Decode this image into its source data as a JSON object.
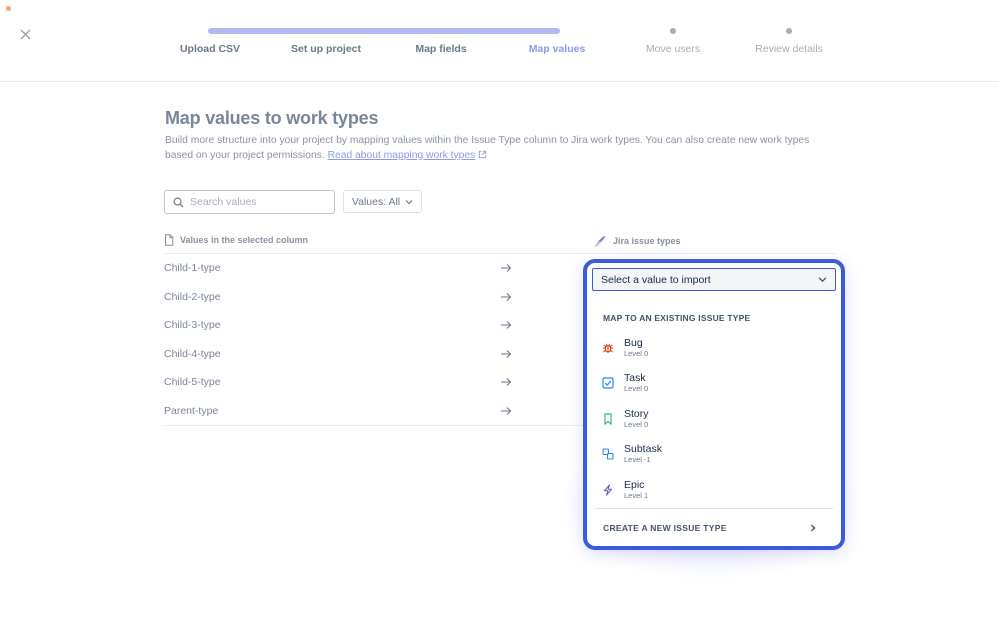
{
  "steps": [
    {
      "label": "Upload CSV",
      "state": "done"
    },
    {
      "label": "Set up project",
      "state": "done"
    },
    {
      "label": "Map fields",
      "state": "done"
    },
    {
      "label": "Map values",
      "state": "current"
    },
    {
      "label": "Move users",
      "state": "future"
    },
    {
      "label": "Review details",
      "state": "future"
    }
  ],
  "page": {
    "title": "Map values to work types",
    "description": "Build more structure into your project by mapping values within the Issue Type column to Jira work types. You can also create new work types based on your project permissions.",
    "link_text": "Read about mapping work types"
  },
  "search": {
    "placeholder": "Search values"
  },
  "filter": {
    "label": "Values: All"
  },
  "columns": {
    "left": "Values in the selected column",
    "right": "Jira issue types"
  },
  "rows": [
    {
      "value": "Child-1-type"
    },
    {
      "value": "Child-2-type"
    },
    {
      "value": "Child-3-type"
    },
    {
      "value": "Child-4-type"
    },
    {
      "value": "Child-5-type"
    },
    {
      "value": "Parent-type"
    }
  ],
  "dropdown": {
    "trigger_label": "Select a value to import",
    "group_heading": "MAP TO AN EXISTING ISSUE TYPE",
    "options": [
      {
        "name": "Bug",
        "level": "Level 0",
        "icon": "bug-icon",
        "color": "#de350b"
      },
      {
        "name": "Task",
        "level": "Level 0",
        "icon": "task-icon",
        "color": "#2684ff"
      },
      {
        "name": "Story",
        "level": "Level 0",
        "icon": "story-icon",
        "color": "#36b37e"
      },
      {
        "name": "Subtask",
        "level": "Level -1",
        "icon": "subtask-icon",
        "color": "#2684ff"
      },
      {
        "name": "Epic",
        "level": "Level 1",
        "icon": "epic-icon",
        "color": "#6554c0"
      }
    ],
    "create_label": "CREATE A NEW ISSUE TYPE"
  },
  "colors": {
    "accent": "#3b5bdb",
    "progress": "#b3b9f0",
    "link": "#8c9be6"
  }
}
